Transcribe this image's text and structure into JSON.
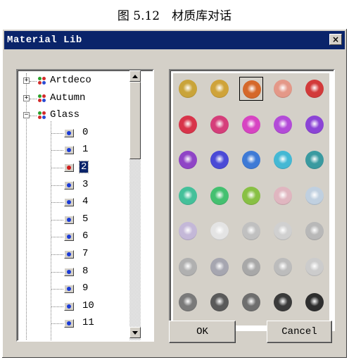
{
  "caption": "图 5.12　材质库对话",
  "window": {
    "title": "Material Lib",
    "close_label": "×"
  },
  "tree": {
    "groups": [
      {
        "label": "Artdeco",
        "expander": "+"
      },
      {
        "label": "Autumn",
        "expander": "+"
      },
      {
        "label": "Glass",
        "expander": "−"
      }
    ],
    "items": [
      "0",
      "1",
      "2",
      "3",
      "4",
      "5",
      "6",
      "7",
      "8",
      "9",
      "10",
      "11"
    ],
    "selected_item": "2"
  },
  "materials": [
    [
      "#c9a43a",
      "#cfa33a",
      "#d5682a",
      "#e49888",
      "#d23a3a"
    ],
    [
      "#d8344a",
      "#d53e7a",
      "#d744c2",
      "#b34bd8",
      "#8b44d6"
    ],
    [
      "#8f44c6",
      "#4a4ad6",
      "#3e7ad6",
      "#44b8d4",
      "#3a9aa0"
    ],
    [
      "#44c09a",
      "#44c070",
      "#88c044",
      "#e0b6c0",
      "#c0d0e0"
    ],
    [
      "#c4b8d8",
      "#e4e4e4",
      "#c0c0c0",
      "#d0d0d0",
      "#b8b8b8"
    ],
    [
      "#b0b0b0",
      "#a6a6b0",
      "#a8a8a8",
      "#bcbcbc",
      "#cccccc"
    ],
    [
      "#7a7a7a",
      "#5a5a5a",
      "#6e6e6e",
      "#3a3a3a",
      "#2e2e2e"
    ]
  ],
  "selected_material": {
    "row": 0,
    "col": 2
  },
  "buttons": {
    "ok": "OK",
    "cancel": "Cancel"
  }
}
